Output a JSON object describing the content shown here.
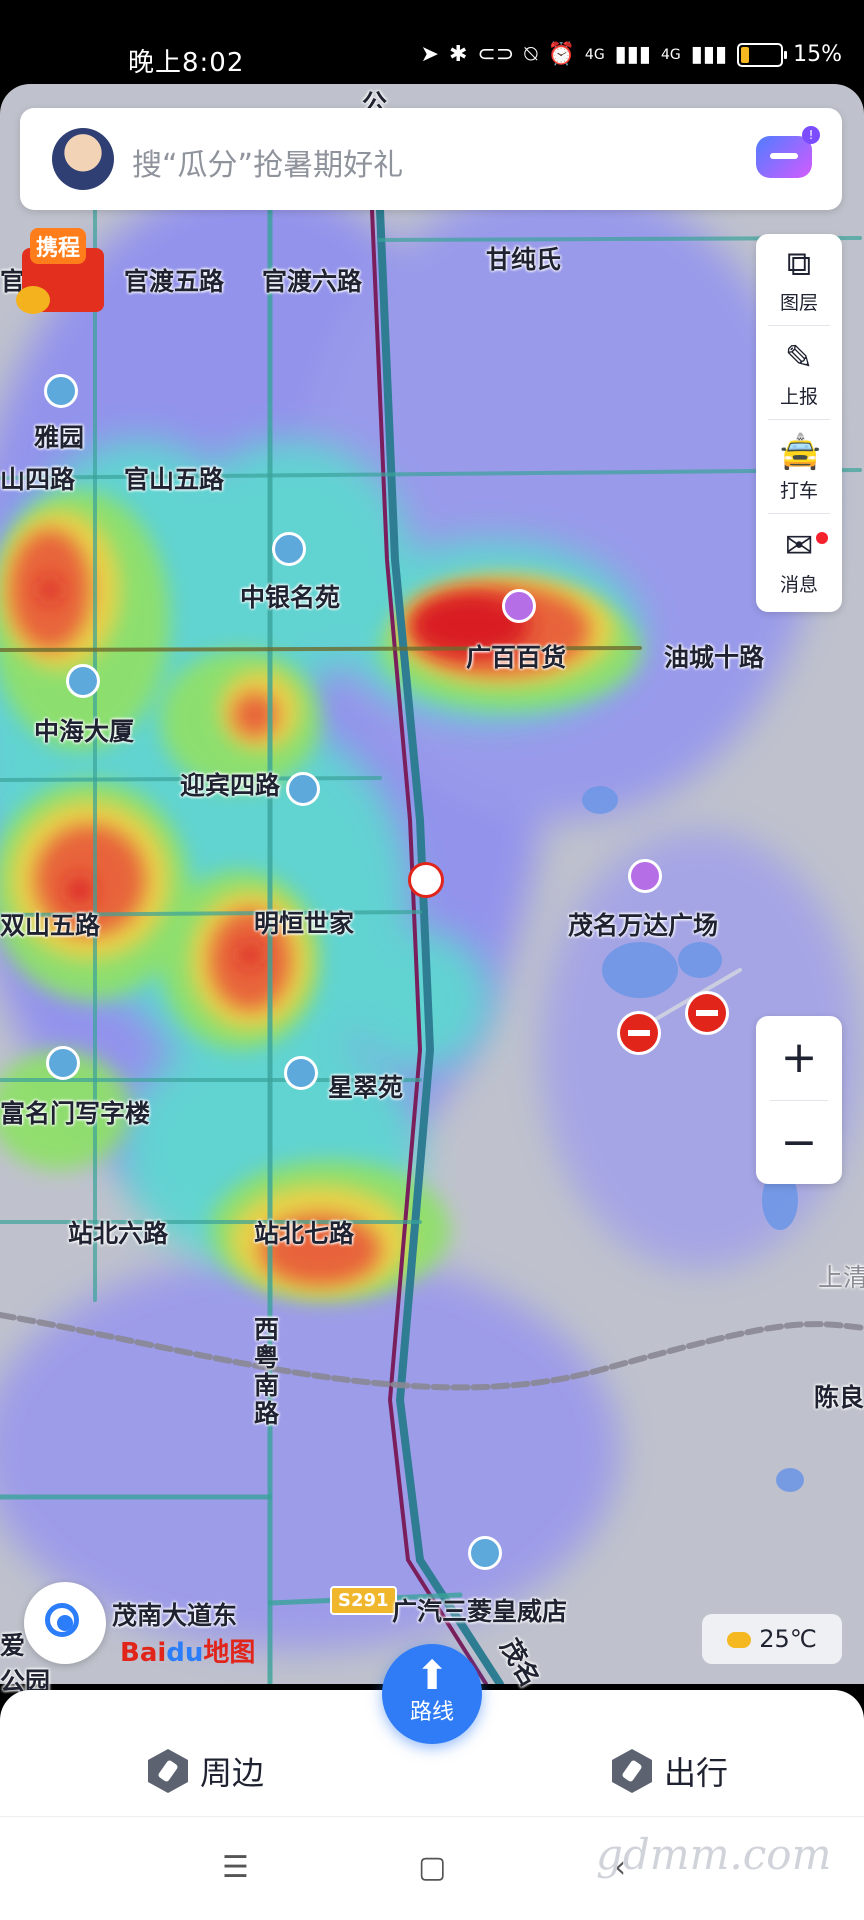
{
  "status_bar": {
    "time": "晚上8:02",
    "network_1": "4G",
    "network_2": "4G",
    "battery": "15%"
  },
  "search": {
    "placeholder": "搜“瓜分”抢暑期好礼",
    "promo_tag": "携程"
  },
  "tools": [
    {
      "label": "图层",
      "icon": "layers-icon"
    },
    {
      "label": "上报",
      "icon": "report-icon"
    },
    {
      "label": "打车",
      "icon": "taxi-icon"
    },
    {
      "label": "消息",
      "icon": "message-icon"
    }
  ],
  "map_labels": {
    "road_guandu5": "官渡五路",
    "road_guandu6": "官渡六路",
    "poi_ganchunshi": "甘纯氏",
    "poi_yayuan": "雅园",
    "road_guanshan4": "山四路",
    "road_guanshan5": "官山五路",
    "poi_zhongyin": "中银名苑",
    "poi_guangbai": "广百百货",
    "road_youcheng10": "油城十路",
    "poi_zhonghai": "中海大厦",
    "road_yingbin4": "迎宾四路",
    "poi_wanda": "茂名万达广场",
    "road_shuangshan5": "双山五路",
    "poi_mingheng": "明恒世家",
    "poi_xingcui": "星翠苑",
    "poi_fuming": "富名门写字楼",
    "road_zhanbei6": "站北六路",
    "road_zhanbei7": "站北七路",
    "road_xiyuenan": "西粤南路",
    "road_maonan": "茂南大道东",
    "highway": "S291",
    "poi_guangqi": "广汽三菱皇威店",
    "road_maoming": "茂名",
    "road_gong": "公",
    "edge_shangqing": "上清",
    "edge_chenliang": "陈良",
    "edge_ai": "爱",
    "edge_gong": "公园",
    "edge_guan": "官渡"
  },
  "weather": {
    "temperature": "25℃"
  },
  "brand": {
    "bai": "Bai",
    "du": "du",
    "map": "地图"
  },
  "bottom_nav": {
    "nearby": "周边",
    "route": "路线",
    "travel": "出行"
  },
  "watermark": "gdmm.com"
}
